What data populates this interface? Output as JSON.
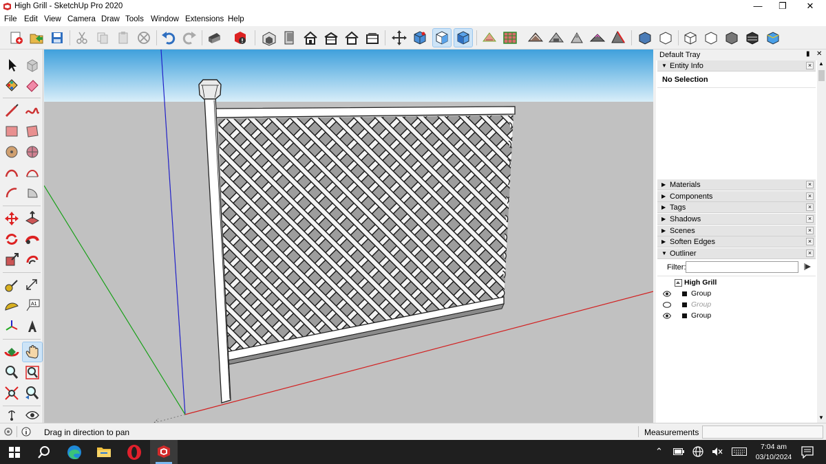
{
  "window": {
    "title": "High Grill - SketchUp Pro 2020"
  },
  "menu": [
    "File",
    "Edit",
    "View",
    "Camera",
    "Draw",
    "Tools",
    "Window",
    "Extensions",
    "Help"
  ],
  "tray": {
    "title": "Default Tray",
    "entity_info": {
      "label": "Entity Info",
      "selection": "No Selection"
    },
    "panels": [
      "Materials",
      "Components",
      "Tags",
      "Shadows",
      "Scenes",
      "Soften Edges"
    ],
    "outliner": {
      "label": "Outliner",
      "filter_label": "Filter:",
      "filter_value": "",
      "model_name": "High Grill",
      "items": [
        {
          "name": "Group",
          "visible": true
        },
        {
          "name": "Group",
          "visible": false
        },
        {
          "name": "Group",
          "visible": true
        }
      ]
    }
  },
  "status": {
    "hint": "Drag in direction to pan",
    "measurements_label": "Measurements",
    "measurements_value": ""
  },
  "clock": {
    "time": "7:04 am",
    "date": "03/10/2024"
  },
  "colors": {
    "sky_top": "#3fa0dc",
    "sky_bottom": "#d8eef9",
    "ground": "#c1c1c1",
    "axis_red": "#d22020",
    "axis_green": "#18a018",
    "axis_blue": "#2020c8"
  }
}
